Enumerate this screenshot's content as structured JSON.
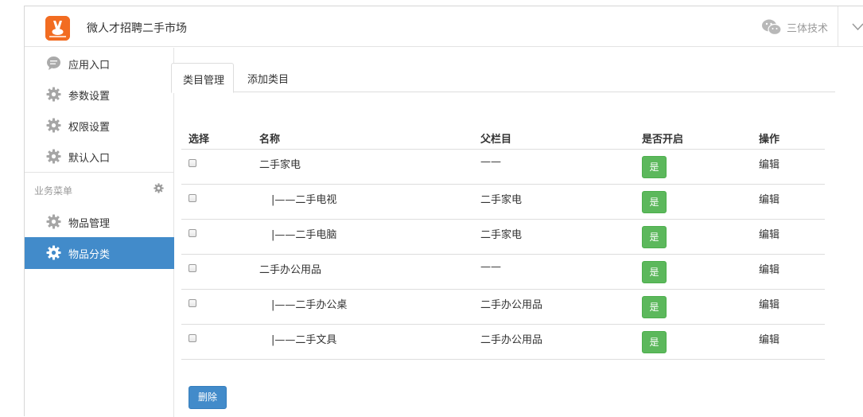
{
  "header": {
    "title": "微人才招聘二手市场",
    "company": "三体技术",
    "logo_icon": "app-logo",
    "company_icon": "wechat-icon",
    "accent": "#f26c21"
  },
  "sidebar": {
    "items": [
      {
        "label": "应用入口",
        "icon": "chat-bubble-icon"
      },
      {
        "label": "参数设置",
        "icon": "gear-icon"
      },
      {
        "label": "权限设置",
        "icon": "gear-icon"
      },
      {
        "label": "默认入口",
        "icon": "gear-icon"
      }
    ],
    "section_title": "业务菜单",
    "section_items": [
      {
        "label": "物品管理",
        "icon": "gear-icon",
        "active": false
      },
      {
        "label": "物品分类",
        "icon": "gear-icon",
        "active": true
      }
    ],
    "active_color": "#428bca"
  },
  "tabs": [
    {
      "label": "类目管理",
      "active": true
    },
    {
      "label": "添加类目",
      "active": false
    }
  ],
  "table": {
    "headers": [
      "选择",
      "名称",
      "父栏目",
      "是否开启",
      "操作"
    ],
    "rows": [
      {
        "name": "二手家电",
        "parent": "——",
        "open": "是",
        "op": "编辑",
        "indent": false
      },
      {
        "name": "|——二手电视",
        "parent": "二手家电",
        "open": "是",
        "op": "编辑",
        "indent": true
      },
      {
        "name": "|——二手电脑",
        "parent": "二手家电",
        "open": "是",
        "op": "编辑",
        "indent": true
      },
      {
        "name": "二手办公用品",
        "parent": "——",
        "open": "是",
        "op": "编辑",
        "indent": false
      },
      {
        "name": "|——二手办公桌",
        "parent": "二手办公用品",
        "open": "是",
        "op": "编辑",
        "indent": true
      },
      {
        "name": "|——二手文具",
        "parent": "二手办公用品",
        "open": "是",
        "op": "编辑",
        "indent": true
      }
    ],
    "badge_color": "#5cb85c"
  },
  "actions": {
    "delete_label": "删除"
  }
}
